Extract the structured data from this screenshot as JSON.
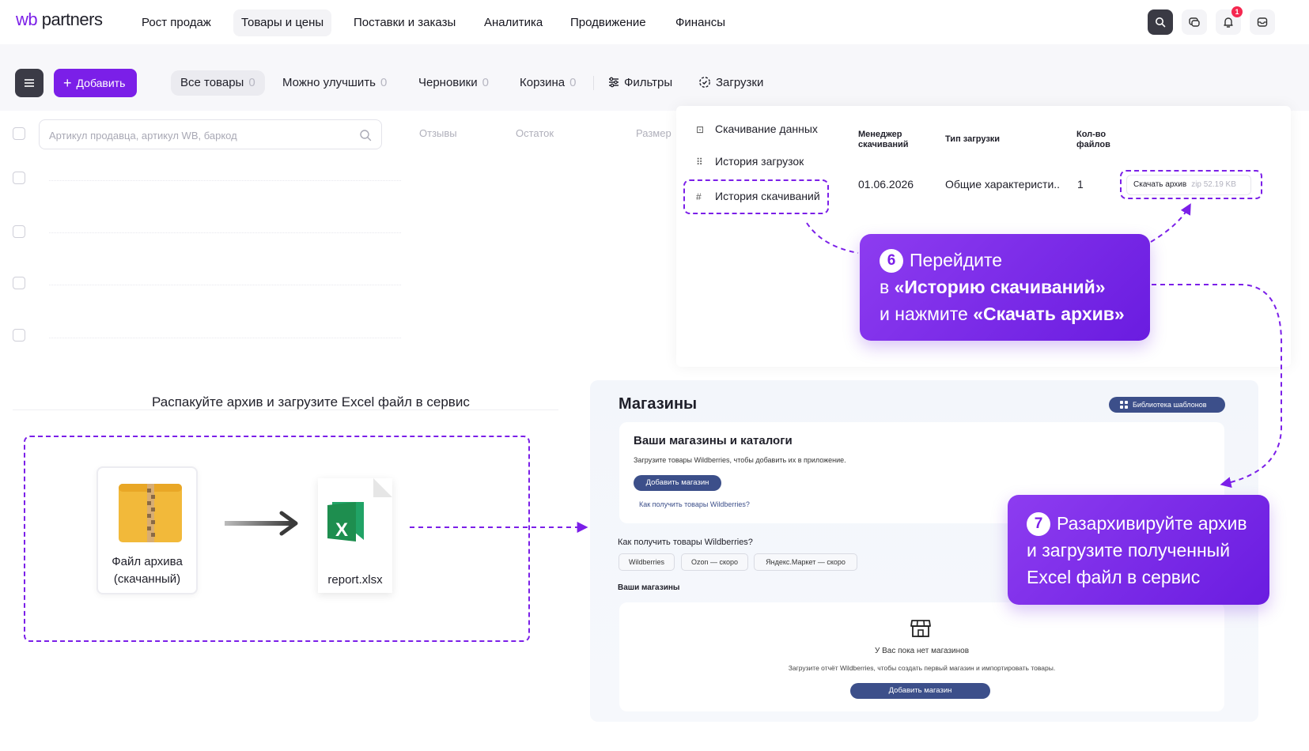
{
  "header": {
    "logo_wb": "wb",
    "logo_partners": "partners",
    "nav": [
      {
        "label": "Рост продаж"
      },
      {
        "label": "Товары и цены"
      },
      {
        "label": "Поставки и заказы"
      },
      {
        "label": "Аналитика"
      },
      {
        "label": "Продвижение"
      },
      {
        "label": "Финансы"
      }
    ],
    "notification_count": "1",
    "icons": [
      "search-icon",
      "chat-icon",
      "bell-icon",
      "inbox-icon"
    ]
  },
  "toolbar": {
    "add_label": "Добавить",
    "tabs": [
      {
        "label": "Все товары",
        "count": "0"
      },
      {
        "label": "Можно улучшить",
        "count": "0"
      },
      {
        "label": "Черновики",
        "count": "0"
      },
      {
        "label": "Корзина",
        "count": "0"
      }
    ],
    "filters_label": "Фильтры",
    "uploads_label": "Загрузки"
  },
  "table": {
    "search_placeholder": "Артикул продавца, артикул WB, баркод",
    "columns": [
      "Отзывы",
      "Остаток",
      "Размер"
    ]
  },
  "downloads": {
    "menu": [
      {
        "label": "Скачивание данных"
      },
      {
        "label": "История загрузок"
      },
      {
        "label": "История скачиваний"
      }
    ],
    "headers": {
      "manager_line1": "Менеджер",
      "manager_line2": "скачиваний",
      "type": "Тип загрузки",
      "count_line1": "Кол-во",
      "count_line2": "файлов"
    },
    "row": {
      "date": "01.06.2026",
      "type": "Общие характеристи..",
      "count": "1",
      "archive_label": "Скачать архив",
      "archive_meta": "zip 52.19 KB"
    }
  },
  "step6": {
    "number": "6",
    "line1": "Перейдите",
    "line2_prefix": "в ",
    "line2_bold": "«Историю скачиваний»",
    "line3_prefix": "и нажмите ",
    "line3_bold": "«Скачать архив»"
  },
  "unpack": {
    "title": "Распакуйте архив и загрузите Excel файл в сервис",
    "zip_line1": "Файл архива",
    "zip_line2": "(скачанный)",
    "xlsx_name": "report.xlsx",
    "xlsx_letter": "X"
  },
  "stores": {
    "title": "Магазины",
    "library_label": "Библиотека шаблонов",
    "card_title": "Ваши магазины и каталоги",
    "card_sub": "Загрузите товары Wildberries, чтобы добавить их в приложение.",
    "add_store_label": "Добавить магазин",
    "how_link": "Как получить товары Wildberries?",
    "how_title": "Как получить товары Wildberries?",
    "chips": [
      "Wildberries",
      "Ozon — скоро",
      "Яндекс.Маркет — скоро"
    ],
    "your_stores": "Ваши магазины",
    "empty_title": "У Вас пока нет магазинов",
    "empty_sub": "Загрузите отчёт Wildberries, чтобы создать первый магазин и импортировать товары.",
    "empty_add_label": "Добавить магазин"
  },
  "step7": {
    "number": "7",
    "line1": "Разархивируйте архив",
    "line2": "и загрузите полученный",
    "line3": "Excel файл в сервис"
  },
  "colors": {
    "brand_purple": "#7b1fe8",
    "dark_button": "#3b3b46",
    "store_blue": "#3c4f8a"
  }
}
